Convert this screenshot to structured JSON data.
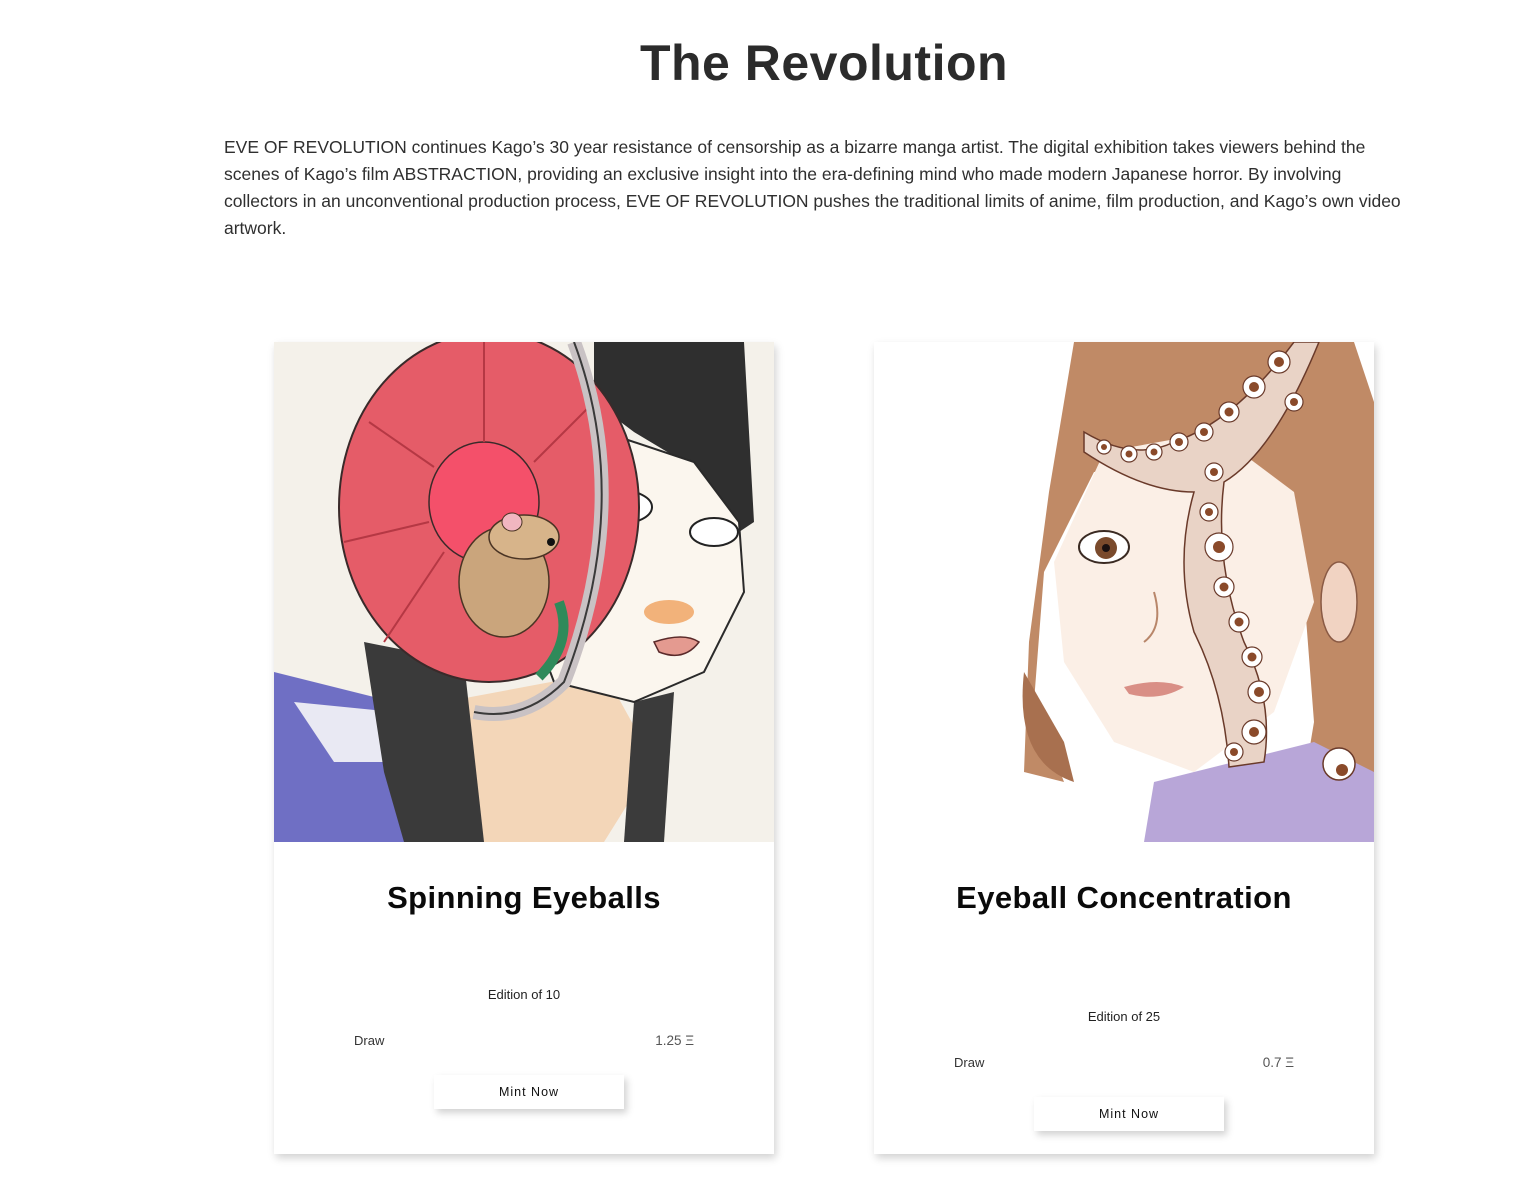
{
  "page": {
    "title": "The Revolution",
    "intro": "EVE OF REVOLUTION continues Kago’s 30 year resistance of censorship as a bizarre manga artist. The digital exhibition takes viewers behind the scenes of Kago’s film ABSTRACTION, providing an exclusive insight into the era-defining mind who made modern Japanese horror. By involving collectors in an unconventional production process, EVE OF REVOLUTION pushes the traditional limits of anime, film production, and Kago’s own video artwork."
  },
  "cards": [
    {
      "title": "Spinning Eyeballs",
      "edition": "Edition of 10",
      "draw_label": "Draw",
      "price": "1.25 Ξ",
      "button_label": "Mint Now"
    },
    {
      "title": "Eyeball Concentration",
      "edition": "Edition of 25",
      "draw_label": "Draw",
      "price": "0.7 Ξ",
      "button_label": "Mint Now"
    }
  ]
}
